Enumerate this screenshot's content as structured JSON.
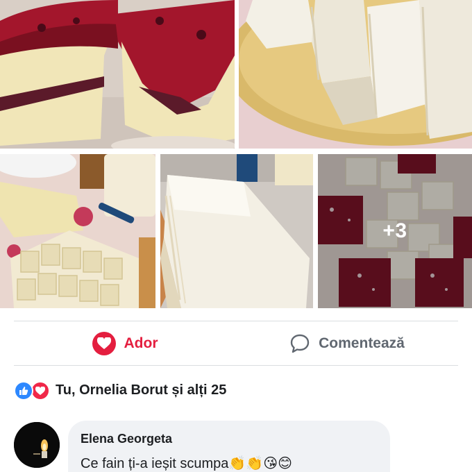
{
  "post_photos": {
    "images": [
      {
        "icon": "berry-layer-cake-photo"
      },
      {
        "icon": "coconut-cake-slices-photo"
      },
      {
        "icon": "cake-squares-on-table-photo"
      },
      {
        "icon": "coconut-cake-slab-photo"
      },
      {
        "icon": "mixed-cake-squares-photo"
      }
    ],
    "more_count": "+3"
  },
  "actions": {
    "love_label": "Ador",
    "comment_label": "Comentează",
    "love_color": "#e41e3f",
    "comment_color": "#606770"
  },
  "reactions": {
    "icons": [
      "like-icon",
      "love-icon"
    ],
    "summary": "Tu, Ornelia Borut și alți 25"
  },
  "comment": {
    "author": "Elena Georgeta",
    "text": "Ce fain ți-a ieșit scumpa👏👏😘😊"
  }
}
